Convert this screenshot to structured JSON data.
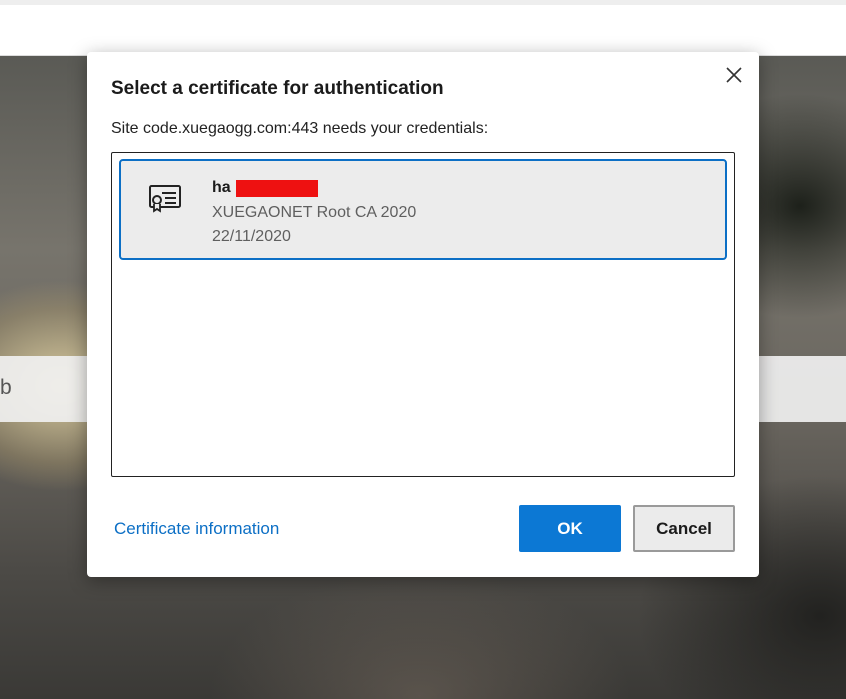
{
  "page": {
    "search_text": "b"
  },
  "dialog": {
    "title": "Select a certificate for authentication",
    "subtitle": "Site code.xuegaogg.com:443 needs your credentials:",
    "close_icon": "close-icon",
    "certificates": [
      {
        "name": "ha",
        "name_redacted": true,
        "issuer": "XUEGAONET Root CA 2020",
        "date": "22/11/2020",
        "icon": "certificate-icon",
        "selected": true
      }
    ],
    "certificate_info_link": "Certificate information",
    "ok_label": "OK",
    "cancel_label": "Cancel"
  },
  "colors": {
    "accent": "#0c78d4",
    "link": "#0c6fc5",
    "selected_background": "#ececec",
    "redaction": "#ee1111"
  }
}
